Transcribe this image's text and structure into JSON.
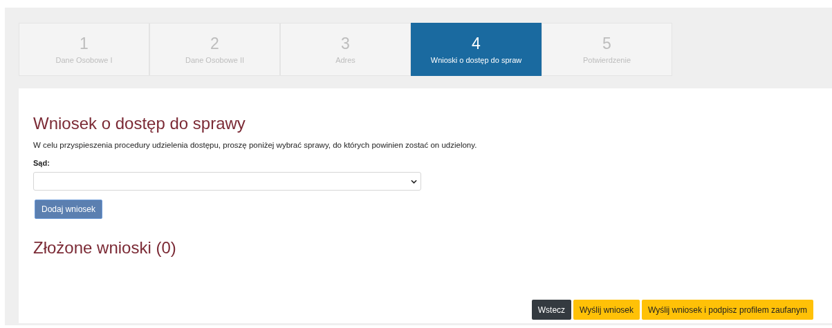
{
  "steps": [
    {
      "number": "1",
      "label": "Dane Osobowe I",
      "selected": false
    },
    {
      "number": "2",
      "label": "Dane Osobowe II",
      "selected": false
    },
    {
      "number": "3",
      "label": "Adres",
      "selected": false
    },
    {
      "number": "4",
      "label": "Wnioski o dostęp do spraw",
      "selected": true
    },
    {
      "number": "5",
      "label": "Potwierdzenie",
      "selected": false
    }
  ],
  "form": {
    "title": "Wniosek o dostęp do sprawy",
    "description": "W celu przyspieszenia procedury udzielenia dostępu, proszę poniżej wybrać sprawy, do których powinien zostać on udzielony.",
    "court_label": "Sąd:",
    "add_button": "Dodaj wniosek"
  },
  "submitted": {
    "title": "Złożone wnioski (0)"
  },
  "actions": [
    {
      "label": "Wstecz",
      "kind": "dark"
    },
    {
      "label": "Wyślij wniosek",
      "kind": "warning"
    },
    {
      "label": "Wyślij wniosek i podpisz profilem zaufanym",
      "kind": "warning"
    }
  ]
}
